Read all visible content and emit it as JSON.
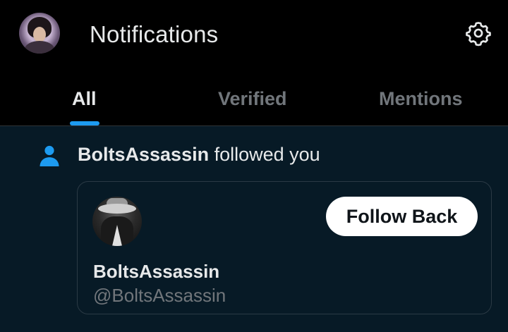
{
  "header": {
    "title": "Notifications",
    "avatar_icon": "profile-avatar",
    "settings_icon": "gear-icon"
  },
  "tabs": [
    {
      "label": "All",
      "selected": true
    },
    {
      "label": "Verified",
      "selected": false
    },
    {
      "label": "Mentions",
      "selected": false
    }
  ],
  "notification": {
    "icon": "person-icon",
    "actor": "BoltsAssassin",
    "action": "followed you",
    "card": {
      "display_name": "BoltsAssassin",
      "handle": "@BoltsAssassin",
      "button_label": "Follow Back"
    }
  },
  "colors": {
    "background": "#000000",
    "notification_bg": "#071a26",
    "accent": "#1d9bf0",
    "text_primary": "#e7e9ea",
    "text_secondary": "#71767b",
    "button_bg": "#ffffff"
  }
}
